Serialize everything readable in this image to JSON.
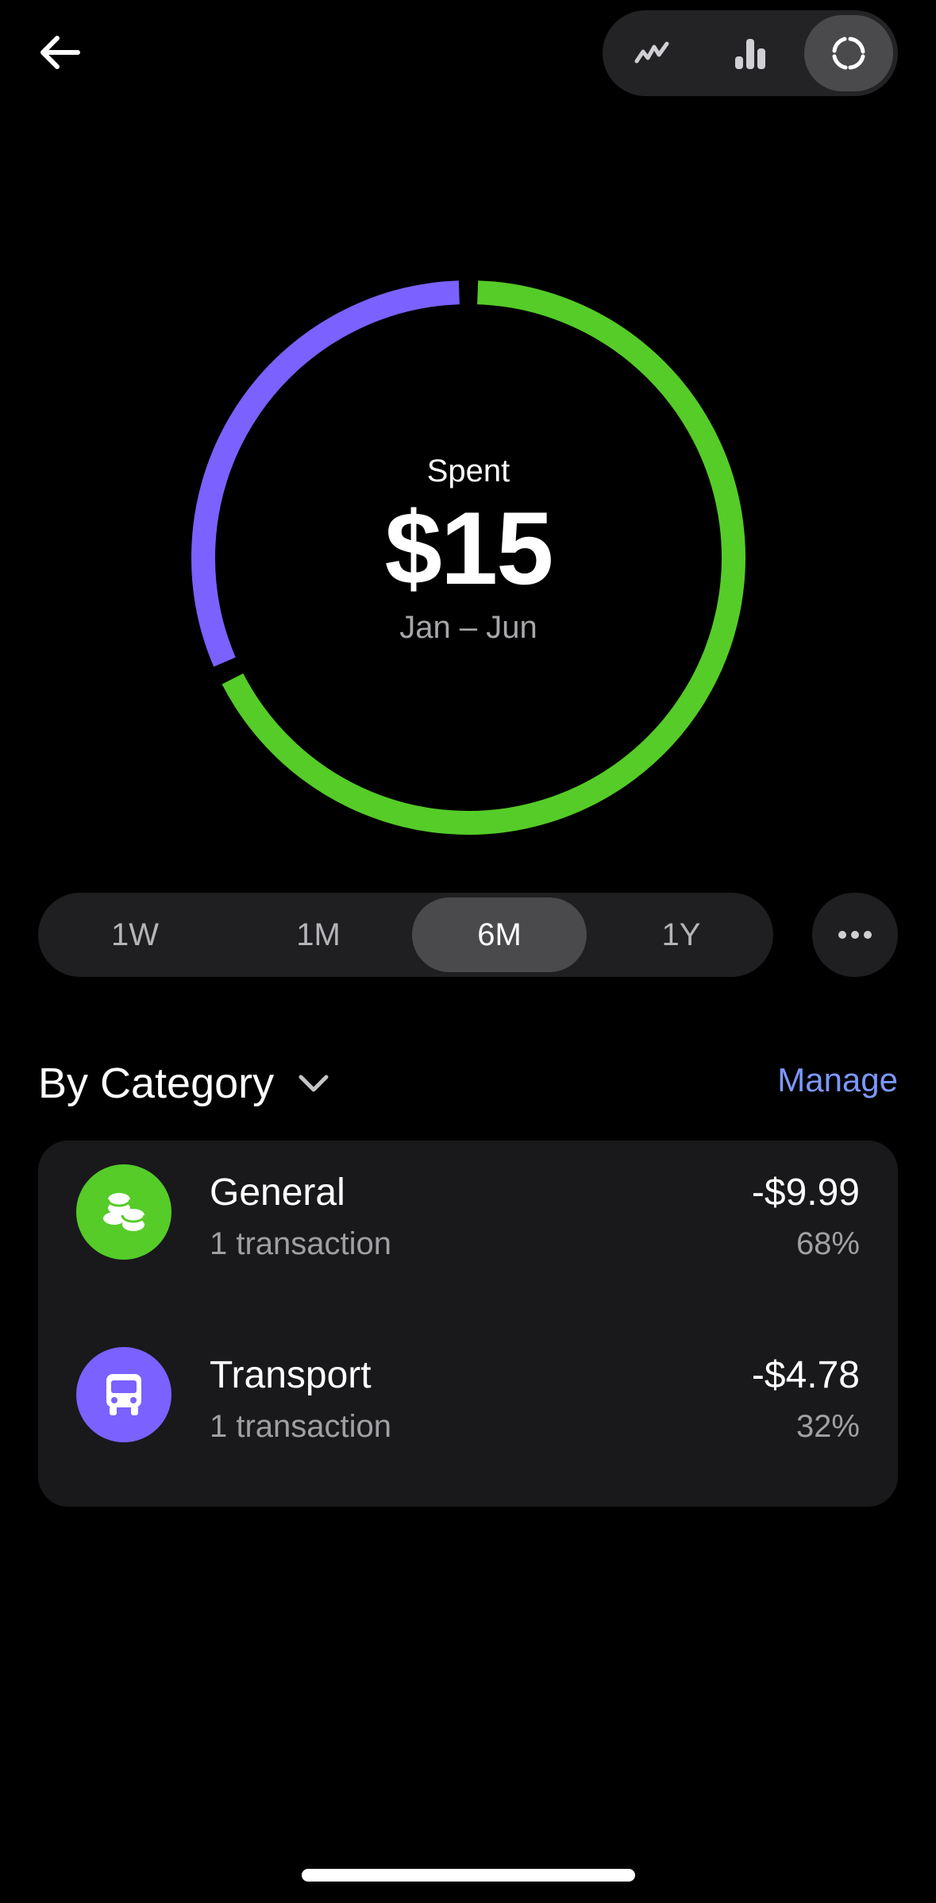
{
  "header": {
    "back_icon": "arrow-left-icon",
    "view_options": [
      {
        "icon": "line-chart-icon",
        "active": false
      },
      {
        "icon": "bar-chart-icon",
        "active": false
      },
      {
        "icon": "donut-chart-icon",
        "active": true
      }
    ]
  },
  "summary": {
    "label": "Spent",
    "amount": "$15",
    "range": "Jan – Jun"
  },
  "chart_data": {
    "type": "pie",
    "categories": [
      "General",
      "Transport"
    ],
    "values": [
      68,
      32
    ],
    "colors": [
      "#55cc28",
      "#7b61ff"
    ]
  },
  "periods": {
    "options": [
      "1W",
      "1M",
      "6M",
      "1Y"
    ],
    "selected": "6M",
    "more_icon": "more-horizontal-icon"
  },
  "category_section": {
    "title": "By Category",
    "dropdown_icon": "chevron-down-icon",
    "manage_label": "Manage",
    "items": [
      {
        "name": "General",
        "subtitle": "1 transaction",
        "amount": "-$9.99",
        "percent": "68%",
        "icon": "coins-icon",
        "color": "#55cc28"
      },
      {
        "name": "Transport",
        "subtitle": "1 transaction",
        "amount": "-$4.78",
        "percent": "32%",
        "icon": "bus-icon",
        "color": "#7b61ff"
      }
    ]
  }
}
